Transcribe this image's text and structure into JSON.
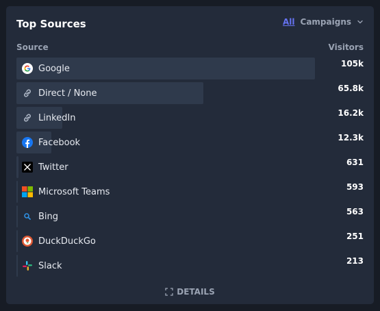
{
  "card": {
    "title": "Top Sources",
    "filter_all": "All",
    "filter_campaigns": "Campaigns",
    "col_source": "Source",
    "col_visitors": "Visitors",
    "details_label": "DETAILS"
  },
  "sources": [
    {
      "label": "Google",
      "value": "105k",
      "icon": "google-icon",
      "share": 1.0
    },
    {
      "label": "Direct / None",
      "value": "65.8k",
      "icon": "link-icon",
      "share": 0.626
    },
    {
      "label": "LinkedIn",
      "value": "16.2k",
      "icon": "link-icon",
      "share": 0.154
    },
    {
      "label": "Facebook",
      "value": "12.3k",
      "icon": "facebook-icon",
      "share": 0.117
    },
    {
      "label": "Twitter",
      "value": "631",
      "icon": "x-icon",
      "share": 0.006
    },
    {
      "label": "Microsoft Teams",
      "value": "593",
      "icon": "microsoft-teams-icon",
      "share": 0.0056
    },
    {
      "label": "Bing",
      "value": "563",
      "icon": "bing-icon",
      "share": 0.0054
    },
    {
      "label": "DuckDuckGo",
      "value": "251",
      "icon": "duckduckgo-icon",
      "share": 0.0024
    },
    {
      "label": "Slack",
      "value": "213",
      "icon": "slack-icon",
      "share": 0.002
    }
  ],
  "colors": {
    "background": "#171c25",
    "card": "#232b3a",
    "bar": "#2f3a4c",
    "accent": "#6673f2"
  }
}
